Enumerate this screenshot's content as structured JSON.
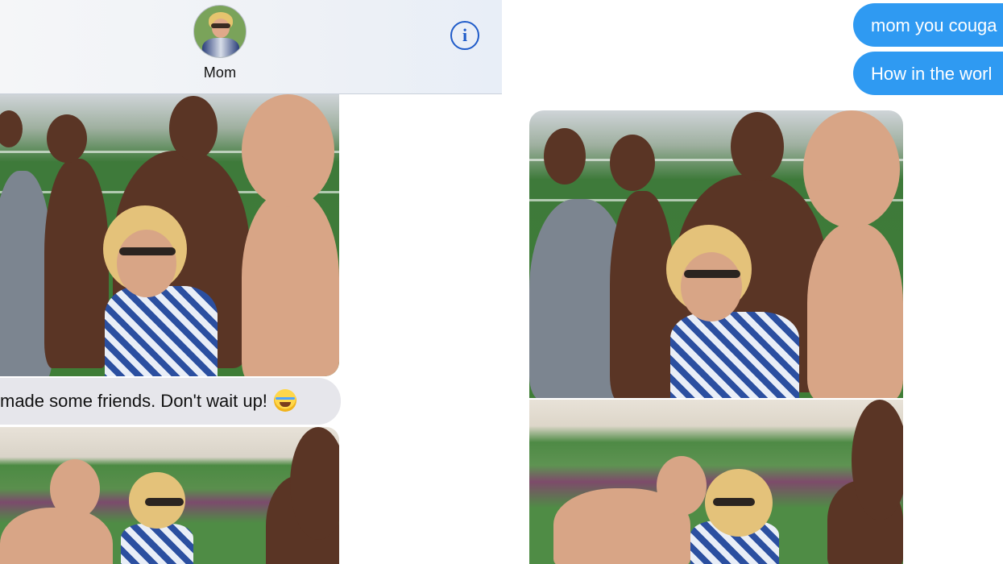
{
  "left_panel": {
    "header": {
      "contact_name": "Mom",
      "info_icon": "info-icon",
      "info_glyph": "i"
    },
    "messages": [
      {
        "type": "image",
        "description_icon": "photo-thumbnail"
      },
      {
        "type": "text",
        "text": "made some friends. Don't wait up!",
        "emoji_icon": "laughing-tears-emoji"
      },
      {
        "type": "image",
        "description_icon": "photo-thumbnail"
      }
    ]
  },
  "right_panel": {
    "sent_messages": [
      {
        "text": "mom you couga"
      },
      {
        "text": "How in the worl"
      }
    ],
    "photos": [
      {
        "description_icon": "photo-thumbnail"
      },
      {
        "description_icon": "photo-thumbnail"
      }
    ]
  },
  "colors": {
    "sent_bubble": "#2f9af2",
    "received_bubble": "#e6e6eb",
    "info_icon": "#1f5bc9"
  }
}
